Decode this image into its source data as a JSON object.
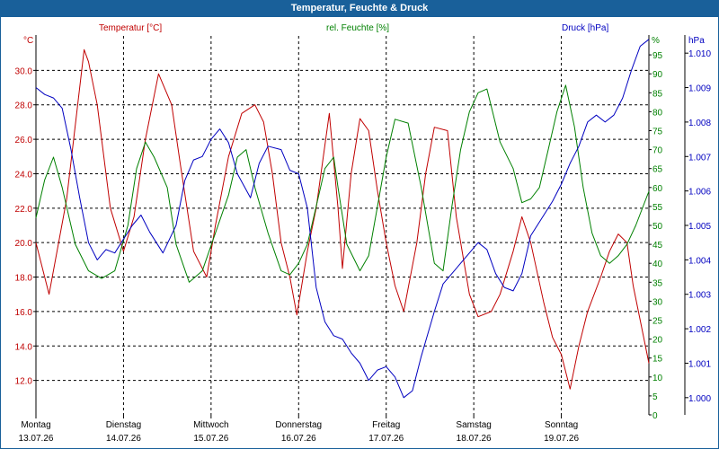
{
  "title": "Temperatur, Feuchte & Druck",
  "colors": {
    "temperature": "#c00000",
    "humidity": "#008000",
    "pressure": "#0000c0",
    "titlebar": "#19609a"
  },
  "chart_data": {
    "type": "line",
    "title": "Temperatur, Feuchte & Druck",
    "grid": true,
    "legend_placement": "top",
    "x_unit": "days",
    "xlim": [
      0,
      7
    ],
    "x_ticks": [
      {
        "day": "Montag",
        "date": "13.07.26"
      },
      {
        "day": "Dienstag",
        "date": "14.07.26"
      },
      {
        "day": "Mittwoch",
        "date": "15.07.26"
      },
      {
        "day": "Donnerstag",
        "date": "16.07.26"
      },
      {
        "day": "Freitag",
        "date": "17.07.26"
      },
      {
        "day": "Samstag",
        "date": "18.07.26"
      },
      {
        "day": "Sonntag",
        "date": "19.07.26"
      }
    ],
    "axes": {
      "temperature": {
        "label": "Temperatur [°C]",
        "unit": "°C",
        "ylim": [
          10,
          32
        ],
        "ticks": [
          "12.0",
          "14.0",
          "16.0",
          "18.0",
          "20.0",
          "22.0",
          "24.0",
          "26.0",
          "28.0",
          "30.0"
        ],
        "tick_values": [
          12,
          14,
          16,
          18,
          20,
          22,
          24,
          26,
          28,
          30
        ]
      },
      "humidity": {
        "label": "rel. Feuchte [%]",
        "unit": "%",
        "ylim": [
          0,
          100
        ],
        "ticks": [
          "0",
          "5",
          "10",
          "15",
          "20",
          "25",
          "30",
          "35",
          "40",
          "45",
          "50",
          "55",
          "60",
          "65",
          "70",
          "75",
          "80",
          "85",
          "90",
          "95"
        ],
        "tick_values": [
          0,
          5,
          10,
          15,
          20,
          25,
          30,
          35,
          40,
          45,
          50,
          55,
          60,
          65,
          70,
          75,
          80,
          85,
          90,
          95
        ]
      },
      "pressure": {
        "label": "Druck [hPa]",
        "unit": "hPa",
        "ylim": [
          0.9995,
          1.0105
        ],
        "ticks": [
          "1.000",
          "1.001",
          "1.002",
          "1.003",
          "1.004",
          "1.005",
          "1.006",
          "1.007",
          "1.008",
          "1.009",
          "1.010"
        ],
        "tick_values": [
          1.0,
          1.001,
          1.002,
          1.003,
          1.004,
          1.005,
          1.006,
          1.007,
          1.008,
          1.009,
          1.01
        ]
      }
    },
    "series": [
      {
        "name": "Temperatur [°C]",
        "axis": "temperature",
        "x": [
          0,
          0.15,
          0.35,
          0.55,
          0.6,
          0.7,
          0.85,
          1.0,
          1.12,
          1.25,
          1.4,
          1.55,
          1.65,
          1.8,
          1.95,
          2.05,
          2.2,
          2.35,
          2.5,
          2.6,
          2.7,
          2.8,
          2.9,
          2.98,
          3.1,
          3.2,
          3.35,
          3.45,
          3.5,
          3.6,
          3.7,
          3.8,
          3.9,
          4.0,
          4.1,
          4.2,
          4.35,
          4.45,
          4.55,
          4.7,
          4.8,
          4.95,
          5.05,
          5.2,
          5.3,
          5.45,
          5.55,
          5.65,
          5.8,
          5.9,
          6.0,
          6.1,
          6.2,
          6.3,
          6.45,
          6.55,
          6.65,
          6.75,
          6.82,
          6.9,
          7.0
        ],
        "values": [
          20.0,
          17.0,
          22.5,
          31.2,
          30.5,
          28.0,
          22.0,
          19.5,
          21.5,
          26.0,
          29.8,
          28.0,
          24.5,
          19.5,
          18.0,
          21.0,
          25.0,
          27.5,
          28.0,
          27.0,
          24.0,
          20.0,
          18.0,
          15.8,
          19.5,
          22.0,
          27.5,
          22.0,
          18.5,
          24.0,
          27.2,
          26.5,
          23.0,
          20.0,
          17.5,
          16.0,
          20.0,
          24.0,
          26.7,
          26.5,
          21.5,
          17.0,
          15.7,
          16.0,
          17.0,
          19.5,
          21.5,
          20.0,
          16.5,
          14.5,
          13.5,
          11.5,
          14.0,
          16.0,
          18.0,
          19.5,
          20.5,
          20.0,
          17.5,
          15.5,
          13.0
        ]
      },
      {
        "name": "rel. Feuchte [%]",
        "axis": "humidity",
        "x": [
          0,
          0.1,
          0.2,
          0.3,
          0.45,
          0.6,
          0.75,
          0.9,
          1.05,
          1.15,
          1.25,
          1.35,
          1.5,
          1.6,
          1.75,
          1.9,
          2.05,
          2.2,
          2.3,
          2.4,
          2.5,
          2.65,
          2.8,
          2.9,
          3.0,
          3.1,
          3.2,
          3.3,
          3.4,
          3.45,
          3.55,
          3.7,
          3.8,
          3.9,
          4.0,
          4.1,
          4.25,
          4.4,
          4.55,
          4.65,
          4.75,
          4.85,
          4.95,
          5.05,
          5.15,
          5.3,
          5.45,
          5.55,
          5.65,
          5.75,
          5.85,
          5.95,
          6.05,
          6.15,
          6.25,
          6.35,
          6.45,
          6.55,
          6.65,
          6.75,
          6.85,
          7.0
        ],
        "values": [
          52,
          62,
          68,
          60,
          45,
          38,
          36,
          38,
          50,
          65,
          72,
          68,
          60,
          45,
          35,
          38,
          48,
          58,
          68,
          70,
          60,
          48,
          38,
          37,
          40,
          45,
          55,
          65,
          68,
          60,
          45,
          38,
          42,
          55,
          68,
          78,
          77,
          60,
          40,
          38,
          55,
          70,
          80,
          85,
          86,
          72,
          65,
          56,
          57,
          60,
          70,
          80,
          87,
          76,
          60,
          48,
          42,
          40,
          42,
          45,
          50,
          59
        ]
      },
      {
        "name": "Druck [hPa]",
        "axis": "pressure",
        "x": [
          0,
          0.1,
          0.2,
          0.3,
          0.4,
          0.5,
          0.6,
          0.7,
          0.8,
          0.9,
          1.0,
          1.1,
          1.2,
          1.3,
          1.45,
          1.6,
          1.7,
          1.8,
          1.9,
          2.0,
          2.1,
          2.2,
          2.3,
          2.45,
          2.55,
          2.65,
          2.8,
          2.9,
          3.0,
          3.1,
          3.2,
          3.3,
          3.4,
          3.5,
          3.6,
          3.7,
          3.8,
          3.9,
          4.0,
          4.1,
          4.2,
          4.3,
          4.4,
          4.55,
          4.65,
          4.75,
          4.85,
          4.95,
          5.05,
          5.15,
          5.25,
          5.35,
          5.45,
          5.55,
          5.65,
          5.8,
          5.9,
          6.0,
          6.1,
          6.2,
          6.3,
          6.4,
          6.5,
          6.6,
          6.7,
          6.8,
          6.9,
          7.0
        ],
        "values": [
          1.009,
          1.0088,
          1.0087,
          1.0084,
          1.0072,
          1.0058,
          1.0045,
          1.004,
          1.0043,
          1.0042,
          1.0046,
          1.005,
          1.0053,
          1.0048,
          1.0042,
          1.005,
          1.0063,
          1.0069,
          1.007,
          1.0075,
          1.0078,
          1.0074,
          1.0065,
          1.0058,
          1.0068,
          1.0073,
          1.0072,
          1.0066,
          1.0065,
          1.0055,
          1.0032,
          1.0022,
          1.0018,
          1.0017,
          1.0013,
          1.001,
          1.0005,
          1.0008,
          1.0009,
          1.0006,
          1.0,
          1.0002,
          1.0012,
          1.0025,
          1.0033,
          1.0036,
          1.0039,
          1.0042,
          1.0045,
          1.0043,
          1.0036,
          1.0032,
          1.0031,
          1.0036,
          1.0047,
          1.0053,
          1.0057,
          1.0062,
          1.0068,
          1.0073,
          1.008,
          1.0082,
          1.008,
          1.0082,
          1.0087,
          1.0095,
          1.0102,
          1.0104
        ]
      }
    ]
  }
}
